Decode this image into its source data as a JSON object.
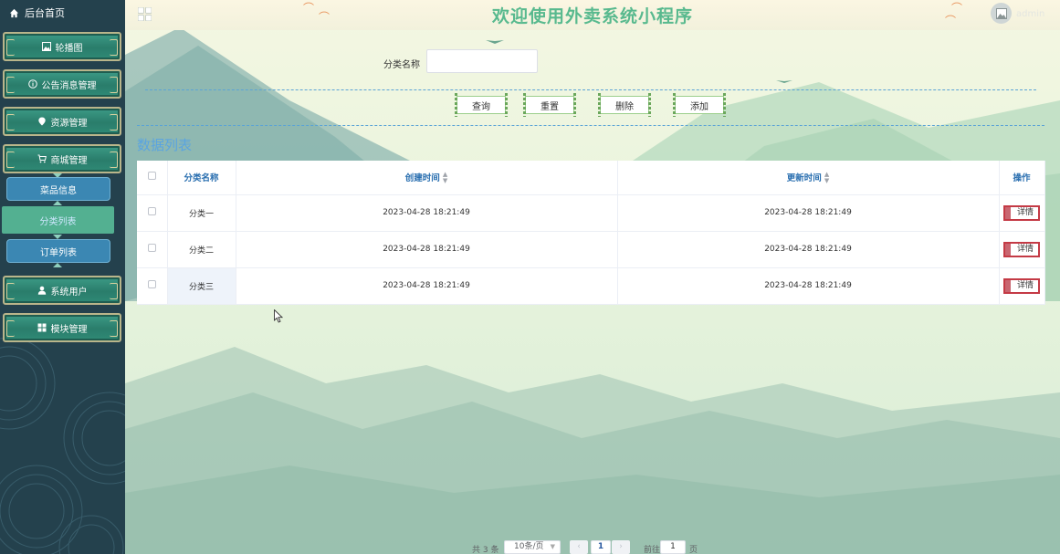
{
  "app": {
    "title": "欢迎使用外卖系统小程序",
    "username": "admin"
  },
  "sidebar": {
    "home_label": "后台首页",
    "items": [
      {
        "label": "轮播图",
        "icon": "image-icon"
      },
      {
        "label": "公告消息管理",
        "icon": "info-circle-icon"
      },
      {
        "label": "资源管理",
        "icon": "location-pin-icon"
      },
      {
        "label": "商城管理",
        "icon": "cart-icon"
      },
      {
        "label": "系统用户",
        "icon": "user-icon"
      },
      {
        "label": "模块管理",
        "icon": "grid-icon"
      }
    ],
    "subitems": [
      {
        "label": "菜品信息",
        "active": false
      },
      {
        "label": "分类列表",
        "active": true
      },
      {
        "label": "订单列表",
        "active": false
      }
    ]
  },
  "search": {
    "label": "分类名称",
    "value": "",
    "placeholder": ""
  },
  "actions": {
    "query": "查询",
    "reset": "重置",
    "delete": "删除",
    "add": "添加"
  },
  "section_title": "数据列表",
  "table": {
    "columns": [
      "分类名称",
      "创建时间",
      "更新时间",
      "操作"
    ],
    "rows": [
      {
        "name": "分类一",
        "created": "2023-04-28 18:21:49",
        "updated": "2023-04-28 18:21:49",
        "action": "详情"
      },
      {
        "name": "分类二",
        "created": "2023-04-28 18:21:49",
        "updated": "2023-04-28 18:21:49",
        "action": "详情"
      },
      {
        "name": "分类三",
        "created": "2023-04-28 18:21:49",
        "updated": "2023-04-28 18:21:49",
        "action": "详情"
      }
    ]
  },
  "pagination": {
    "total_text": "共 3 条",
    "page_size": "10条/页",
    "current_page": "1",
    "goto_label": "前往",
    "goto_value": "1",
    "page_suffix": "页",
    "prev": "‹",
    "next": "›"
  },
  "colors": {
    "sidebar_bg": "#24414d",
    "menu_item": "#2f8a76",
    "subitem": "#3b87b3",
    "subitem_active": "#53b091",
    "title": "#58b98e",
    "section_title": "#5aa4e0",
    "detail_border": "#c43a45"
  }
}
